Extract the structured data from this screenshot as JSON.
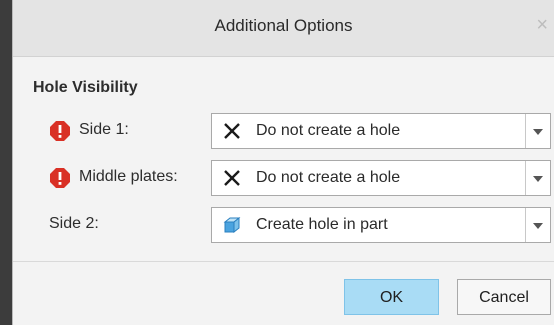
{
  "dialog": {
    "title": "Additional Options",
    "close_glyph": "×"
  },
  "section": {
    "title": "Hole Visibility"
  },
  "rows": [
    {
      "label": "Side 1:",
      "value": "Do not create a hole",
      "value_icon": "x-icon",
      "status_icon": "error-icon"
    },
    {
      "label": "Middle plates:",
      "value": "Do not create a hole",
      "value_icon": "x-icon",
      "status_icon": "error-icon"
    },
    {
      "label": "Side 2:",
      "value": "Create hole in part",
      "value_icon": "cube-icon",
      "status_icon": ""
    }
  ],
  "buttons": {
    "ok": "OK",
    "cancel": "Cancel"
  },
  "colors": {
    "error": "#d93025",
    "ok_button": "#a9dcf5",
    "cube": "#4aa3df"
  }
}
